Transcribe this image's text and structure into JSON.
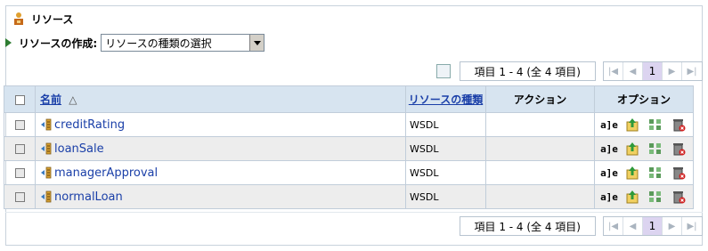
{
  "header": {
    "title": "リソース"
  },
  "create": {
    "label": "リソースの作成:",
    "select_value": "リソースの種類の選択"
  },
  "pager": {
    "range": "項目 1 - 4 (全 4 項目)",
    "page": "1"
  },
  "table": {
    "columns": {
      "name": "名前",
      "sort_indicator": "△",
      "type": "リソースの種類",
      "action": "アクション",
      "options": "オプション"
    },
    "rows": [
      {
        "name": "creditRating",
        "type": "WSDL",
        "action": ""
      },
      {
        "name": "loanSale",
        "type": "WSDL",
        "action": ""
      },
      {
        "name": "managerApproval",
        "type": "WSDL",
        "action": ""
      },
      {
        "name": "normalLoan",
        "type": "WSDL",
        "action": ""
      }
    ],
    "option_icons": [
      "edit-text-icon",
      "export-icon",
      "tree-icon",
      "delete-icon"
    ],
    "option_edit_glyph": "a]e"
  },
  "colors": {
    "header_bg": "#d7e4f0",
    "link": "#1a3fa8",
    "alt_row": "#ededed",
    "current_page": "#dcd4f0"
  }
}
